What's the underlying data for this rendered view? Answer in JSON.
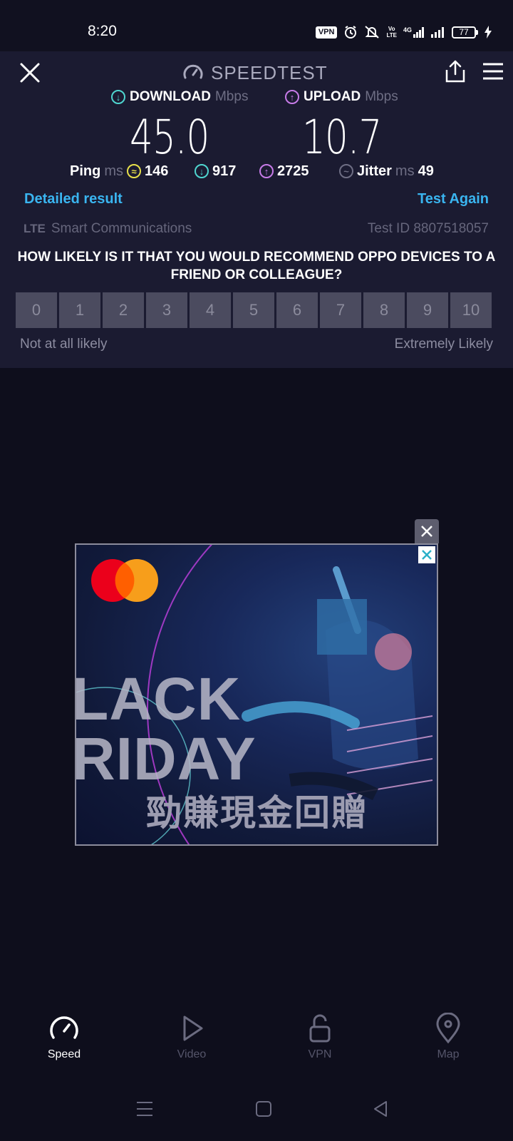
{
  "status_bar": {
    "time": "8:20",
    "vpn": "VPN",
    "volte_top": "Vo",
    "volte_bottom": "LTE",
    "network": "4G",
    "battery": "77"
  },
  "header": {
    "title": "SPEEDTEST"
  },
  "download": {
    "label": "DOWNLOAD",
    "unit": "Mbps",
    "value": "45.0"
  },
  "upload": {
    "label": "UPLOAD",
    "unit": "Mbps",
    "value": "10.7"
  },
  "stats": {
    "ping_label": "Ping",
    "ping_unit": "ms",
    "ping_value": "146",
    "download_latency": "917",
    "upload_latency": "2725",
    "jitter_label": "Jitter",
    "jitter_unit": "ms",
    "jitter_value": "49"
  },
  "actions": {
    "detailed": "Detailed result",
    "test_again": "Test Again"
  },
  "meta": {
    "network_type": "LTE",
    "provider": "Smart Communications",
    "test_id": "Test ID 8807518057"
  },
  "survey": {
    "question": "HOW LIKELY IS IT THAT YOU WOULD RECOMMEND OPPO DEVICES TO A FRIEND OR COLLEAGUE?",
    "scale": [
      "0",
      "1",
      "2",
      "3",
      "4",
      "5",
      "6",
      "7",
      "8",
      "9",
      "10"
    ],
    "low_label": "Not at all likely",
    "high_label": "Extremely Likely"
  },
  "ad": {
    "line1": "LACK",
    "line2": "RIDAY",
    "chinese": "勁賺現金回贈"
  },
  "nav": {
    "items": [
      {
        "label": "Speed"
      },
      {
        "label": "Video"
      },
      {
        "label": "VPN"
      },
      {
        "label": "Map"
      }
    ]
  },
  "colors": {
    "accent_blue": "#3ab5f0",
    "download_icon": "#4fd6d0",
    "upload_icon": "#c77be8",
    "ping_icon": "#e8e04a",
    "panel_bg": "#1b1b31",
    "page_bg": "#0e0e1c"
  }
}
